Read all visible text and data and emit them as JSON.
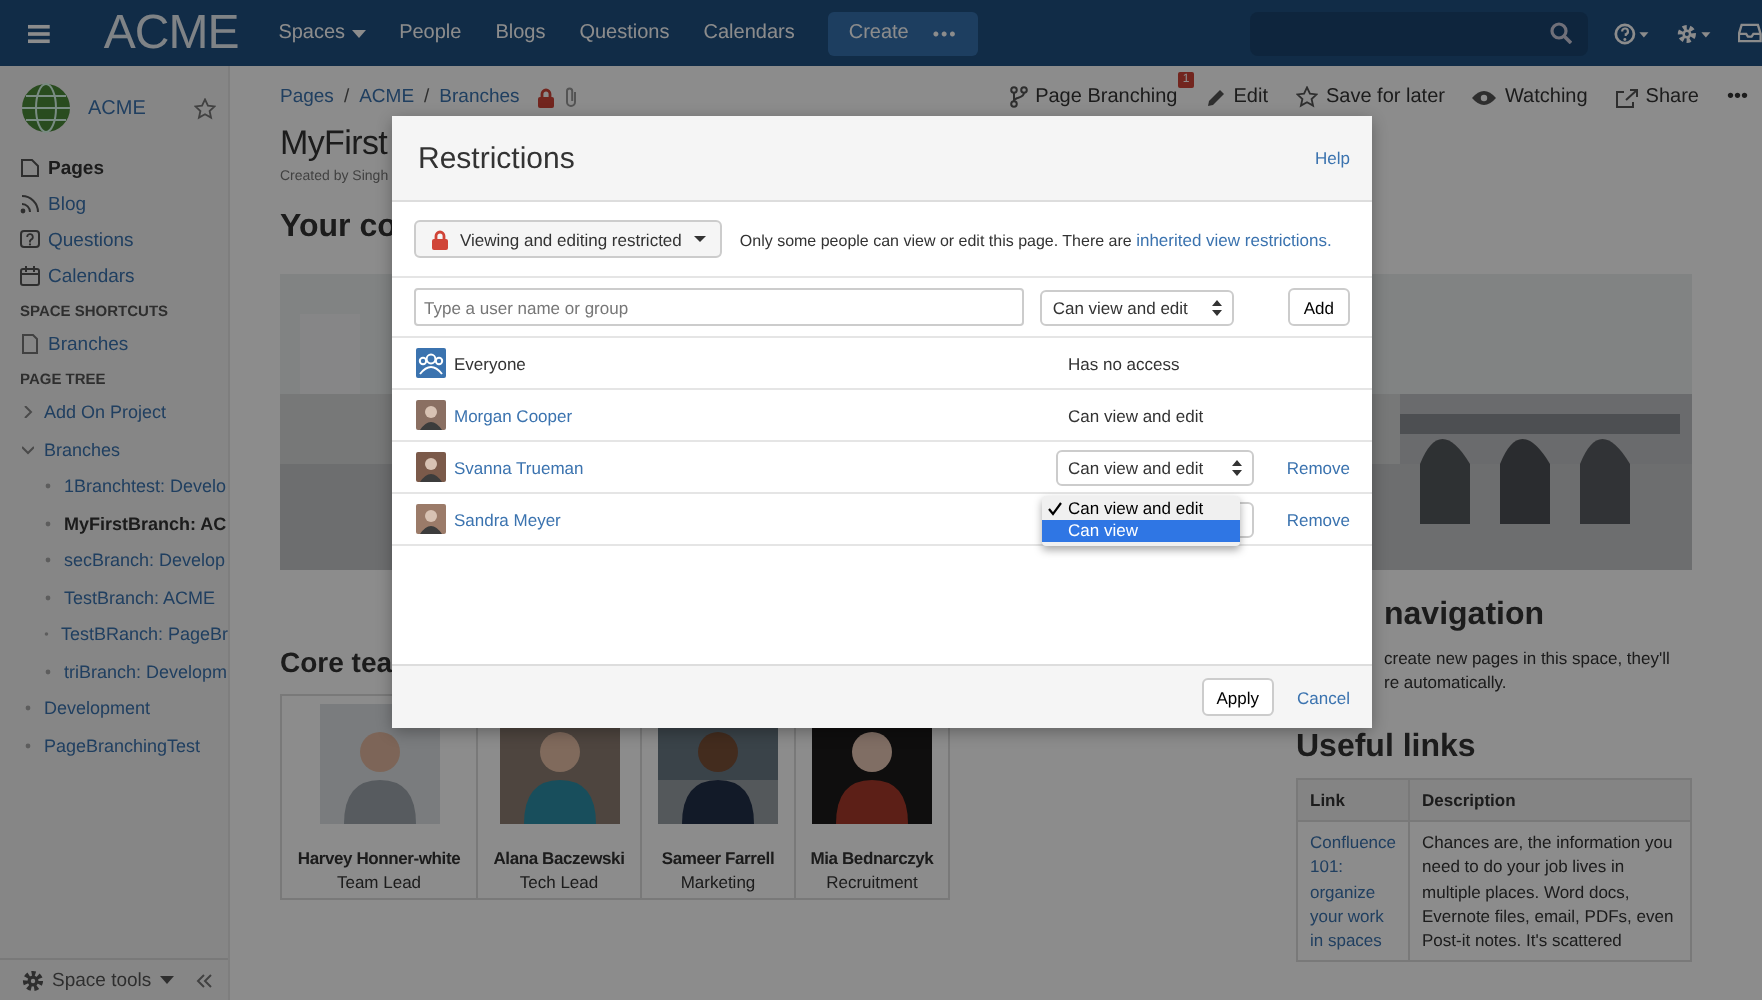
{
  "top_nav": {
    "logo": "ACME",
    "menu": [
      {
        "label": "Spaces",
        "dropdown": true
      },
      {
        "label": "People",
        "dropdown": false
      },
      {
        "label": "Blogs",
        "dropdown": false
      },
      {
        "label": "Questions",
        "dropdown": false
      },
      {
        "label": "Calendars",
        "dropdown": false
      }
    ],
    "create": "Create",
    "more": "•••"
  },
  "sidebar": {
    "space_name": "ACME",
    "nav": [
      {
        "label": "Pages",
        "selected": true
      },
      {
        "label": "Blog",
        "selected": false
      },
      {
        "label": "Questions",
        "selected": false
      },
      {
        "label": "Calendars",
        "selected": false
      }
    ],
    "shortcuts_heading": "SPACE SHORTCUTS",
    "shortcuts": [
      "Branches"
    ],
    "tree_heading": "PAGE TREE",
    "tree": [
      {
        "label": "Add On Project",
        "expanded": false,
        "selected": false
      },
      {
        "label": "Branches",
        "expanded": true,
        "selected": false,
        "children": [
          {
            "label": "1Branchtest: Develo",
            "selected": false
          },
          {
            "label": "MyFirstBranch: AC",
            "selected": true
          },
          {
            "label": "secBranch: Develop",
            "selected": false
          },
          {
            "label": "TestBranch: ACME",
            "selected": false
          },
          {
            "label": "TestBRanch: PageBr",
            "selected": false
          },
          {
            "label": "triBranch: Developm",
            "selected": false
          }
        ]
      },
      {
        "label": "Development",
        "selected": false
      },
      {
        "label": "PageBranchingTest",
        "selected": false
      }
    ],
    "footer": "Space tools"
  },
  "page": {
    "breadcrumbs": [
      {
        "kind": "link",
        "text": "Pages"
      },
      {
        "kind": "separator",
        "text": "/"
      },
      {
        "kind": "link",
        "text": "ACME"
      },
      {
        "kind": "separator",
        "text": "/"
      },
      {
        "kind": "link",
        "text": "Branches"
      }
    ],
    "actions": [
      {
        "label": "Page Branching",
        "badge": "1"
      },
      {
        "label": "Edit"
      },
      {
        "label": "Save for later"
      },
      {
        "label": "Watching"
      },
      {
        "label": "Share"
      }
    ],
    "more": "•••",
    "title": "MyFirst",
    "byline": "Created by Singh",
    "heading": "Your co",
    "team_heading": "Core tea",
    "team": [
      {
        "name": "Harvey Honner-white",
        "role": "Team Lead"
      },
      {
        "name": "Alana Baczewski",
        "role": "Tech Lead"
      },
      {
        "name": "Sameer Farrell",
        "role": "Marketing"
      },
      {
        "name": "Mia Bednarczyk",
        "role": "Recruitment"
      }
    ],
    "quick_nav": {
      "heading": "navigation",
      "lines": [
        "create new pages in this space, they'll",
        "re automatically."
      ]
    },
    "links": {
      "heading": "Useful links",
      "columns": [
        "Link",
        "Description"
      ],
      "rows": [
        {
          "link": "Confluence 101: organize your work in spaces",
          "description": "Chances are, the information you need to do your job lives in multiple places. Word docs, Evernote files, email, PDFs, even Post-it notes. It's scattered"
        }
      ]
    }
  },
  "dialog": {
    "title": "Restrictions",
    "help": "Help",
    "mode_button": "Viewing and editing restricted",
    "notice_text": "Only some people can view or edit this page. There are",
    "notice_link": "inherited view restrictions.",
    "add_placeholder": "Type a user name or group",
    "add_permission": "Can view and edit",
    "add_button": "Add",
    "entries": [
      {
        "name": "Everyone",
        "kind": "group",
        "permission": "Has no access",
        "editable": false
      },
      {
        "name": "Morgan Cooper",
        "kind": "user",
        "permission": "Can view and edit",
        "editable": false
      },
      {
        "name": "Svanna Trueman",
        "kind": "user",
        "permission": "Can view and edit",
        "editable": true,
        "remove": "Remove"
      },
      {
        "name": "Sandra Meyer",
        "kind": "user",
        "editable": true,
        "remove": "Remove",
        "menu": [
          {
            "label": "Can view and edit",
            "checked": true,
            "highlighted": false
          },
          {
            "label": "Can view",
            "checked": false,
            "highlighted": true
          }
        ]
      }
    ],
    "apply": "Apply",
    "cancel": "Cancel"
  }
}
